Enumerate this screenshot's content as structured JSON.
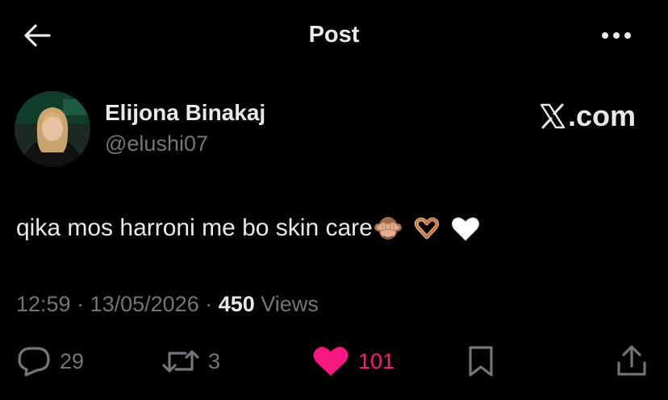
{
  "header": {
    "title": "Post"
  },
  "author": {
    "name": "Elijona Binakaj",
    "handle": "@elushi07"
  },
  "watermark": {
    "text": ".com"
  },
  "tweet": {
    "text": "qika mos harroni me bo skin care",
    "emojis": [
      "see-no-evil-monkey",
      "heart-hands",
      "white-heart"
    ]
  },
  "meta": {
    "time": "12:59",
    "separator": " · ",
    "date": "13/05/2026",
    "views_count": "450",
    "views_label": " Views"
  },
  "actions": {
    "reply_count": "29",
    "repost_count": "3",
    "like_count": "101"
  },
  "colors": {
    "background": "#000000",
    "text_primary": "#e7e9ea",
    "text_secondary": "#71767b",
    "like": "#f91880"
  }
}
